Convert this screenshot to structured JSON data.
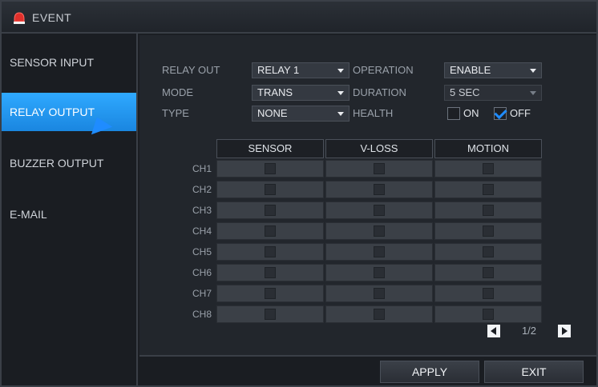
{
  "window": {
    "title": "EVENT"
  },
  "sidebar": {
    "items": [
      {
        "label": "SENSOR INPUT"
      },
      {
        "label": "RELAY OUTPUT"
      },
      {
        "label": "BUZZER OUTPUT"
      },
      {
        "label": "E-MAIL"
      }
    ]
  },
  "form": {
    "relay_out": {
      "label": "RELAY OUT",
      "value": "RELAY 1"
    },
    "mode": {
      "label": "MODE",
      "value": "TRANS"
    },
    "type": {
      "label": "TYPE",
      "value": "NONE"
    },
    "operation": {
      "label": "OPERATION",
      "value": "ENABLE"
    },
    "duration": {
      "label": "DURATION",
      "value": "5 SEC"
    },
    "health": {
      "label": "HEALTH",
      "on_label": "ON",
      "off_label": "OFF",
      "on_checked": false,
      "off_checked": true
    }
  },
  "table": {
    "headers": [
      "SENSOR",
      "V-LOSS",
      "MOTION"
    ],
    "rows": [
      "CH1",
      "CH2",
      "CH3",
      "CH4",
      "CH5",
      "CH6",
      "CH7",
      "CH8"
    ]
  },
  "pager": {
    "text": "1/2"
  },
  "footer": {
    "apply": "APPLY",
    "exit": "EXIT"
  },
  "colors": {
    "accent": "#1f8cff",
    "title_icon": "#e0302b"
  },
  "icons": {
    "title": "alarm-siren-icon",
    "pager_prev": "triangle-left-icon",
    "pager_next": "triangle-right-icon"
  }
}
